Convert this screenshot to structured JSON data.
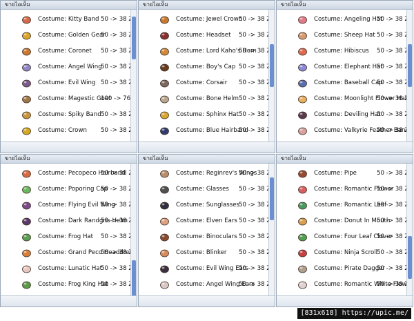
{
  "windows": [
    {
      "title": "ขายไอเท็ม",
      "items": [
        {
          "name": "Costume: Kitty Band",
          "price": "50 -> 38 Z",
          "icon_color": "#d46a4a"
        },
        {
          "name": "Costume: Golden Gear",
          "price": "50 -> 38 Z",
          "icon_color": "#d9a52c"
        },
        {
          "name": "Costume: Coronet",
          "price": "50 -> 38 Z",
          "icon_color": "#c9782e"
        },
        {
          "name": "Costume: Angel Wing",
          "price": "50 -> 38 Z",
          "icon_color": "#8d88c8"
        },
        {
          "name": "Costume: Evil Wing",
          "price": "50 -> 38 Z",
          "icon_color": "#7a5a8c"
        },
        {
          "name": "Costume: Magestic Goat",
          "price": "100 -> 76 Z",
          "icon_color": "#a0784a"
        },
        {
          "name": "Costume: Spiky Band",
          "price": "50 -> 38 Z",
          "icon_color": "#c8963c"
        },
        {
          "name": "Costume: Crown",
          "price": "50 -> 38 Z",
          "icon_color": "#d4a820"
        }
      ]
    },
    {
      "title": "ขายไอเท็ม",
      "items": [
        {
          "name": "Costume: Jewel Crown",
          "price": "50 -> 38 Z",
          "icon_color": "#c9782e"
        },
        {
          "name": "Costume: Headset",
          "price": "50 -> 38 Z",
          "icon_color": "#8a3030"
        },
        {
          "name": "Costume: Lord Kaho's Horn",
          "price": "50 -> 38 Z",
          "icon_color": "#d08a3a"
        },
        {
          "name": "Costume: Boy's Cap",
          "price": "50 -> 38 Z",
          "icon_color": "#6a3c20"
        },
        {
          "name": "Costume: Corsair",
          "price": "50 -> 38 Z",
          "icon_color": "#7a6a60"
        },
        {
          "name": "Costume: Bone Helm",
          "price": "50 -> 38 Z",
          "icon_color": "#b8a890"
        },
        {
          "name": "Costume: Sphinx Hat",
          "price": "50 -> 38 Z",
          "icon_color": "#d8a830"
        },
        {
          "name": "Costume: Blue Hairband",
          "price": "50 -> 38 Z",
          "icon_color": "#303c70"
        }
      ]
    },
    {
      "title": "ขายไอเท็ม",
      "items": [
        {
          "name": "Costume: Angeling Hat",
          "price": "50 -> 38 Z",
          "icon_color": "#e07a88"
        },
        {
          "name": "Costume: Sheep Hat",
          "price": "50 -> 38 Z",
          "icon_color": "#d89a70"
        },
        {
          "name": "Costume: Hibiscus",
          "price": "50 -> 38 Z",
          "icon_color": "#e06a50"
        },
        {
          "name": "Costume: Elephant Hat",
          "price": "50 -> 38 Z",
          "icon_color": "#8a8ad8"
        },
        {
          "name": "Costume: Baseball Cap",
          "price": "50 -> 38 Z",
          "icon_color": "#5a70b0"
        },
        {
          "name": "Costume: Moonlight Flower Hat",
          "price": "50 -> 38 Z",
          "icon_color": "#e8b060"
        },
        {
          "name": "Costume: Deviling Hat",
          "price": "50 -> 38 Z",
          "icon_color": "#5a3a50"
        },
        {
          "name": "Costume: Valkyrie Feather Band",
          "price": "50 -> 38 Z",
          "icon_color": "#d8a0a0"
        }
      ]
    },
    {
      "title": "ขายไอเท็ม",
      "items": [
        {
          "name": "Costume: Pecopeco Hairband",
          "price": "50 -> 38 Z",
          "icon_color": "#d86a40"
        },
        {
          "name": "Costume: Poporing Cap",
          "price": "50 -> 38 Z",
          "icon_color": "#6ab860"
        },
        {
          "name": "Costume: Flying Evil Wing",
          "price": "50 -> 38 Z",
          "icon_color": "#7a4a8a"
        },
        {
          "name": "Costume: Dark Randgris Helm",
          "price": "50 -> 38 Z",
          "icon_color": "#5a3a6a"
        },
        {
          "name": "Costume: Frog Hat",
          "price": "50 -> 38 Z",
          "icon_color": "#5aa050"
        },
        {
          "name": "Costume: Grand Peco Headdress",
          "price": "50 -> 38 Z",
          "icon_color": "#d8803a"
        },
        {
          "name": "Costume: Lunatic Hat",
          "price": "50 -> 38 Z",
          "icon_color": "#e8c8c0"
        },
        {
          "name": "Costume: Frog King Hat",
          "price": "50 -> 38 Z",
          "icon_color": "#5a9a48"
        }
      ]
    },
    {
      "title": "ขายไอเท็ม",
      "items": [
        {
          "name": "Costume: Reginrev's Wings",
          "price": "50 -> 38 Z",
          "icon_color": "#b89070"
        },
        {
          "name": "Costume: Glasses",
          "price": "50 -> 38 Z",
          "icon_color": "#505050"
        },
        {
          "name": "Costume: Sunglasses",
          "price": "50 -> 38 Z",
          "icon_color": "#303040"
        },
        {
          "name": "Costume: Elven Ears",
          "price": "50 -> 38 Z",
          "icon_color": "#e0a080"
        },
        {
          "name": "Costume: Binoculars",
          "price": "50 -> 38 Z",
          "icon_color": "#8a4a30"
        },
        {
          "name": "Costume: Blinker",
          "price": "50 -> 38 Z",
          "icon_color": "#d88a5a"
        },
        {
          "name": "Costume: Evil Wing Ears",
          "price": "50 -> 38 Z",
          "icon_color": "#3a3040"
        },
        {
          "name": "Costume: Angel Wing Ears",
          "price": "50 -> 38 Z",
          "icon_color": "#d8c8c8"
        }
      ]
    },
    {
      "title": "ขายไอเท็ม",
      "items": [
        {
          "name": "Costume: Pipe",
          "price": "50 -> 38 Z",
          "icon_color": "#9a4a30"
        },
        {
          "name": "Costume: Romantic Flower",
          "price": "50 -> 38 Z",
          "icon_color": "#d86060"
        },
        {
          "name": "Costume: Romantic Leaf",
          "price": "50 -> 38 Z",
          "icon_color": "#4a9a60"
        },
        {
          "name": "Costume: Donut In Mouth",
          "price": "50 -> 38 Z",
          "icon_color": "#d8a050"
        },
        {
          "name": "Costume: Four Leaf Clover",
          "price": "50 -> 38 Z",
          "icon_color": "#50a050"
        },
        {
          "name": "Costume: Ninja Scroll",
          "price": "50 -> 38 Z",
          "icon_color": "#c84040"
        },
        {
          "name": "Costume: Pirate Dagger",
          "price": "50 -> 38 Z",
          "icon_color": "#b0a090"
        },
        {
          "name": "Costume: Romantic White Flower",
          "price": "50 -> 38 Z",
          "icon_color": "#e0d0d0"
        }
      ]
    }
  ],
  "scroll_thumbs": [
    0.3,
    0.3,
    0.3,
    0.3,
    0.3,
    0.3
  ],
  "watermark": "[831x618] https://upic.me/"
}
